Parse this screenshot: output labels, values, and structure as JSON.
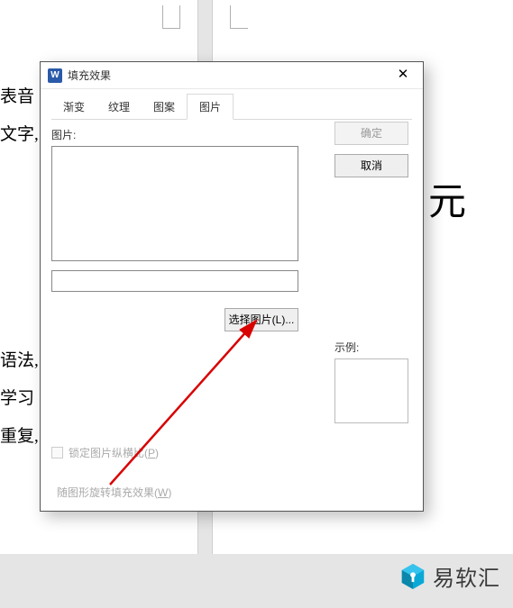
{
  "background": {
    "line1": "表音",
    "line2": "文字,",
    "line3": "语法,",
    "line4": "学习",
    "line5": "重复,",
    "big": "元"
  },
  "dialog": {
    "title": "填充效果",
    "tabs": {
      "t1": "渐变",
      "t2": "纹理",
      "t3": "图案",
      "t4": "图片"
    },
    "image_label": "图片:",
    "select_btn": "选择图片(L)...",
    "ok": "确定",
    "cancel": "取消",
    "sample": "示例:",
    "lock_ratio": "锁定图片纵横比(P)",
    "rotate_with_shape": "随图形旋转填充效果(W)"
  },
  "watermark": {
    "brand": "易软汇"
  }
}
